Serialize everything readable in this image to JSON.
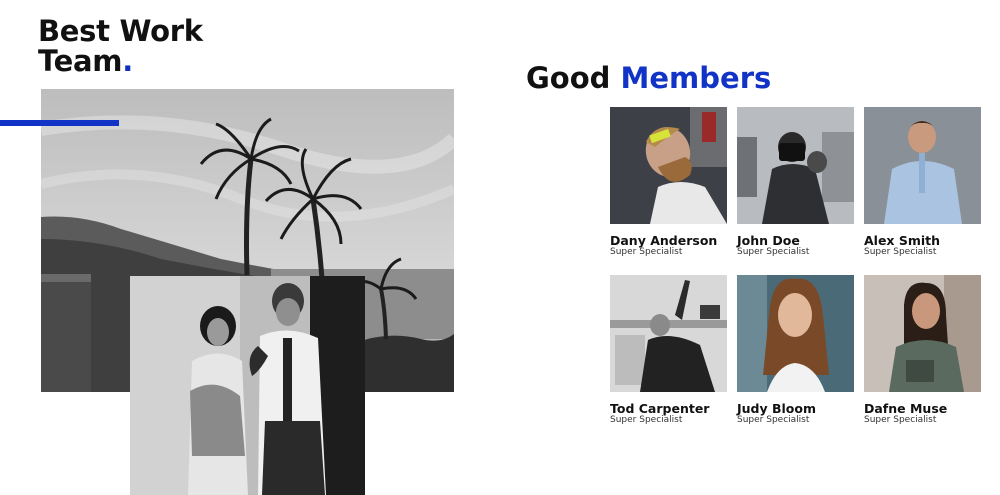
{
  "left": {
    "title_line1": "Best Work",
    "title_line2": "Team",
    "title_dot": ".",
    "accent_color": "#1234c6"
  },
  "right": {
    "title_word1": "Good",
    "title_word2": "Members",
    "accent_color": "#1234c6"
  },
  "members": [
    {
      "name": "Dany Anderson",
      "role": "Super Specialist"
    },
    {
      "name": "John Doe",
      "role": "Super Specialist"
    },
    {
      "name": "Alex Smith",
      "role": "Super Specialist"
    },
    {
      "name": "Tod Carpenter",
      "role": "Super Specialist"
    },
    {
      "name": "Judy Bloom",
      "role": "Super Specialist"
    },
    {
      "name": "Dafne Muse",
      "role": "Super Specialist"
    }
  ]
}
